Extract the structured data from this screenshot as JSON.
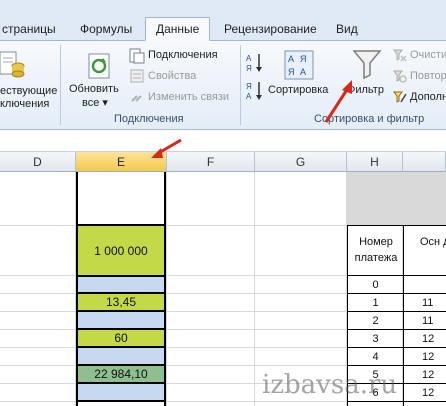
{
  "tabs": [
    {
      "label": "страницы",
      "active": false
    },
    {
      "label": "Формулы",
      "active": false
    },
    {
      "label": "Данные",
      "active": true
    },
    {
      "label": "Рецензирование",
      "active": false
    },
    {
      "label": "Вид",
      "active": false
    }
  ],
  "ribbon": {
    "existing_connections": {
      "line1": "ествующие",
      "line2": "ключения"
    },
    "refresh_all": {
      "line1": "Обновить",
      "line2": "все ▾"
    },
    "connections": "Подключения",
    "properties": "Свойства",
    "edit_links": "Изменить связи",
    "connections_group": "Подключения",
    "sort": "Сортировка",
    "filter": "Фильтр",
    "clear": "Очисти",
    "reapply": "Повтор",
    "advanced": "Дополн",
    "sort_filter_group": "Сортировка и фильтр"
  },
  "columns": [
    "D",
    "E",
    "F",
    "G",
    "H"
  ],
  "cells_E": {
    "e1": "",
    "e2": "1 000 000",
    "e3": "",
    "e4": "13,45",
    "e5": "",
    "e6": "60",
    "e7": "",
    "e8": "22 984,10",
    "e9": ""
  },
  "table": {
    "header_h": "Номер платежа",
    "header_i": "Осн д",
    "rows": [
      {
        "h": "0",
        "i": ""
      },
      {
        "h": "1",
        "i": "11"
      },
      {
        "h": "2",
        "i": "11"
      },
      {
        "h": "3",
        "i": "12"
      },
      {
        "h": "4",
        "i": "12"
      },
      {
        "h": "5",
        "i": "12"
      },
      {
        "h": "6",
        "i": "12"
      }
    ]
  },
  "colors": {
    "accent_green": "#c3d947",
    "light_blue": "#c6d9f1",
    "dark_green": "#8fbf8f",
    "selected_header": "#f3c94b",
    "arrow_red": "#d6291c"
  },
  "watermark": "izbavsa.ru"
}
